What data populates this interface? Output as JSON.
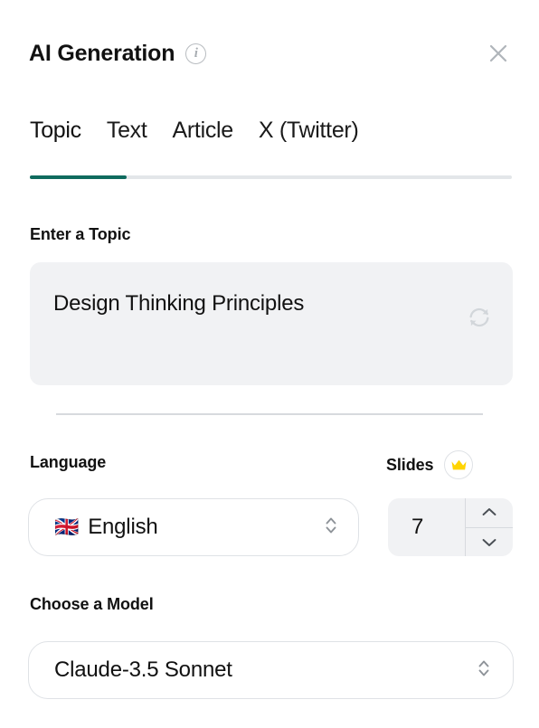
{
  "header": {
    "title": "AI Generation",
    "info_icon": "info-circle-icon",
    "info_glyph": "i",
    "close_icon": "close-icon"
  },
  "tabs": {
    "active_index": 0,
    "items": [
      {
        "label": "Topic"
      },
      {
        "label": "Text"
      },
      {
        "label": "Article"
      },
      {
        "label": "X (Twitter)"
      }
    ],
    "active_color": "#0f6b5e",
    "track_color": "#e3e6e9"
  },
  "topic": {
    "label": "Enter a Topic",
    "value": "Design Thinking Principles",
    "placeholder": "Enter a Topic",
    "refresh_icon": "refresh-icon",
    "background": "#f1f2f4"
  },
  "language": {
    "label": "Language",
    "flag": "🇬🇧",
    "value": "English",
    "chevron_icon": "chevron-up-down-icon"
  },
  "slides": {
    "label": "Slides",
    "value": "7",
    "premium_icon": "crown-icon",
    "premium_color": "#FFD400",
    "increment_icon": "chevron-up-icon",
    "decrement_icon": "chevron-down-icon"
  },
  "model": {
    "label": "Choose a Model",
    "value": "Claude-3.5 Sonnet",
    "chevron_icon": "chevron-up-down-icon"
  }
}
